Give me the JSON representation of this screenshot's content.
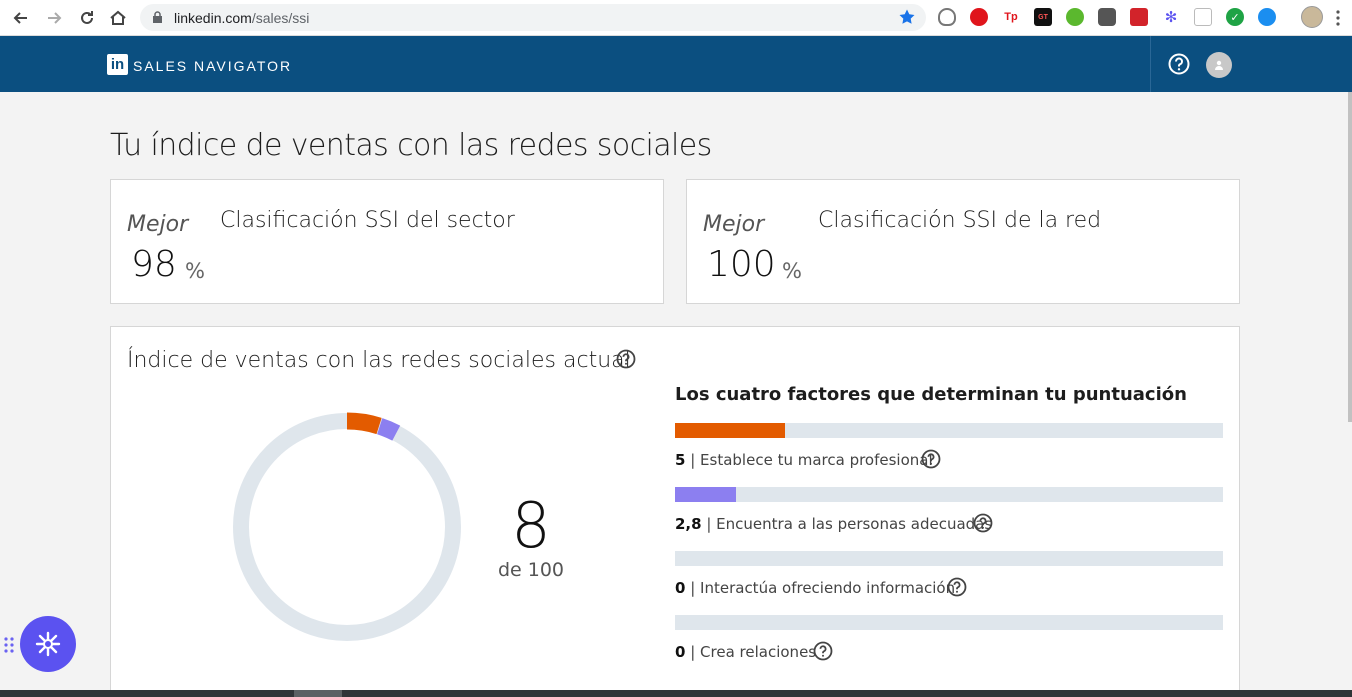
{
  "browser": {
    "url_host": "linkedin.com",
    "url_path": "/sales/ssi"
  },
  "header": {
    "logo_text": "in",
    "title": "SALES NAVIGATOR"
  },
  "page": {
    "title": "Tu índice de ventas con las redes sociales"
  },
  "rankings": [
    {
      "best_label": "Mejor",
      "value": "98",
      "unit": "%",
      "label": "Clasificación SSI del sector"
    },
    {
      "best_label": "Mejor",
      "value": "100",
      "unit": "%",
      "label": "Clasificación SSI de la red"
    }
  ],
  "current": {
    "title": "Índice de ventas con las redes sociales actual",
    "score": "8",
    "score_of": "de 100",
    "score_value": 8,
    "max_score": 100,
    "factors_title": "Los cuatro factores que determinan tu puntuación",
    "factor_max": 25,
    "factors": [
      {
        "score": "5",
        "value": 5,
        "label": "| Establece tu marca profesional",
        "color": "#e35b00"
      },
      {
        "score": "2,8",
        "value": 2.8,
        "label": "| Encuentra a las personas adecuadas",
        "color": "#8c7ff0"
      },
      {
        "score": "0",
        "value": 0,
        "label": "| Interactúa ofreciendo información",
        "color": "#4aa2d9"
      },
      {
        "score": "0",
        "value": 0,
        "label": "| Crea relaciones",
        "color": "#3fae6f"
      }
    ]
  },
  "colors": {
    "header_bg": "#0b4f80",
    "ring_track": "#dfe6ec",
    "fab_bg": "#5b52f0"
  }
}
